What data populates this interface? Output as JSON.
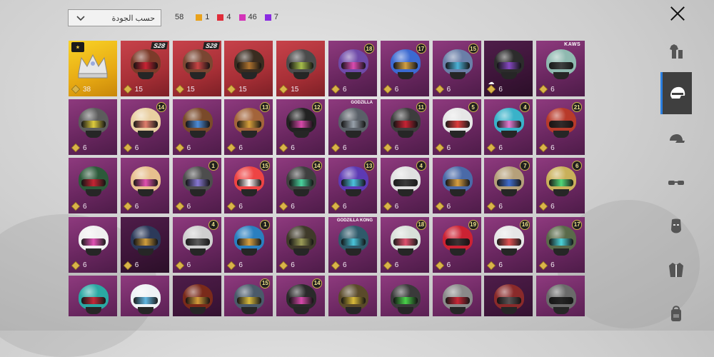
{
  "sort": {
    "label": "حسب الجودة"
  },
  "counts": {
    "total": "58",
    "by_quality": [
      {
        "value": "1",
        "color": "#e9a21b"
      },
      {
        "value": "4",
        "color": "#e02d3a"
      },
      {
        "value": "46",
        "color": "#d334b8"
      },
      {
        "value": "7",
        "color": "#8a2be2"
      }
    ]
  },
  "sidebar": [
    {
      "name": "outfit-tab",
      "icon": "outfit-icon",
      "active": false
    },
    {
      "name": "helmet-tab",
      "icon": "helmet-icon",
      "active": true
    },
    {
      "name": "hat-tab",
      "icon": "cap-icon",
      "active": false
    },
    {
      "name": "glasses-tab",
      "icon": "glasses-icon",
      "active": false
    },
    {
      "name": "mask-tab",
      "icon": "mask-icon",
      "active": false
    },
    {
      "name": "jacket-tab",
      "icon": "jacket-icon",
      "active": false
    },
    {
      "name": "backpack-tab",
      "icon": "backpack-icon",
      "active": false
    }
  ],
  "items": [
    {
      "rarity": "legendary",
      "cost": "38",
      "badge": "",
      "helmet": "#d7d7d7",
      "visor": "#9a9a9a",
      "crown": true
    },
    {
      "rarity": "mythic",
      "cost": "15",
      "tag": "S28",
      "helmet": "#7c3b2a",
      "visor": "#c23"
    },
    {
      "rarity": "mythic",
      "cost": "15",
      "tag": "S28",
      "helmet": "#7a4632",
      "visor": "#c44"
    },
    {
      "rarity": "mythic",
      "cost": "15",
      "helmet": "#3a2c20",
      "visor": "#b4762f"
    },
    {
      "rarity": "mythic",
      "cost": "15",
      "helmet": "#4b4b4b",
      "visor": "#a9c34a"
    },
    {
      "rarity": "epic",
      "cost": "6",
      "level": "18",
      "helmet": "#6f4aa8",
      "visor": "#e04bb1"
    },
    {
      "rarity": "epic",
      "cost": "6",
      "level": "17",
      "helmet": "#3c6ad1",
      "visor": "#d9a23b"
    },
    {
      "rarity": "epic",
      "cost": "6",
      "level": "15",
      "helmet": "#6a7fa8",
      "visor": "#4ab4d9"
    },
    {
      "rarity": "dark",
      "cost": "6",
      "helmet": "#2c2c2c",
      "visor": "#8a4ac9",
      "cloud": true
    },
    {
      "rarity": "epic",
      "cost": "6",
      "tag": "KAWS",
      "helmet": "#8fb9b0",
      "visor": "#3a3a3a"
    },
    {
      "rarity": "epic",
      "cost": "6",
      "helmet": "#5c5c5c",
      "visor": "#e4d13c"
    },
    {
      "rarity": "epic",
      "cost": "6",
      "level": "14",
      "helmet": "#e9cfa1",
      "visor": "#e07a6a"
    },
    {
      "rarity": "epic",
      "cost": "6",
      "helmet": "#7a4a2a",
      "visor": "#4b8fe0"
    },
    {
      "rarity": "epic",
      "cost": "6",
      "level": "13",
      "helmet": "#a3643a",
      "visor": "#d9a23b"
    },
    {
      "rarity": "epic",
      "cost": "6",
      "level": "12",
      "helmet": "#222",
      "visor": "#e04bb1"
    },
    {
      "rarity": "epic",
      "cost": "6",
      "tag": "GODZILLA",
      "helmet": "#5a6068",
      "visor": "#9aa3ad"
    },
    {
      "rarity": "epic",
      "cost": "6",
      "level": "11",
      "helmet": "#3d3d3d",
      "visor": "#c23"
    },
    {
      "rarity": "epic",
      "cost": "6",
      "level": "5",
      "helmet": "#e6e6e6",
      "visor": "#d33"
    },
    {
      "rarity": "epic",
      "cost": "6",
      "level": "4",
      "helmet": "#39b2c9",
      "visor": "#ea7ad0"
    },
    {
      "rarity": "epic",
      "cost": "6",
      "level": "21",
      "helmet": "#b83a2a",
      "visor": "#2a2a2a"
    },
    {
      "rarity": "epic",
      "cost": "6",
      "helmet": "#2d5a3a",
      "visor": "#c23"
    },
    {
      "rarity": "epic",
      "cost": "6",
      "helmet": "#e7c08e",
      "visor": "#e04bb1"
    },
    {
      "rarity": "epic",
      "cost": "6",
      "level": "1",
      "helmet": "#4d4d4d",
      "visor": "#8a7ad9"
    },
    {
      "rarity": "epic",
      "cost": "6",
      "level": "15",
      "helmet": "#e44",
      "visor": "#fff"
    },
    {
      "rarity": "epic",
      "cost": "6",
      "level": "14",
      "helmet": "#3f3f3f",
      "visor": "#4bd9a2"
    },
    {
      "rarity": "epic",
      "cost": "6",
      "level": "13",
      "helmet": "#5d3ab4",
      "visor": "#4bc9e0"
    },
    {
      "rarity": "epic",
      "cost": "6",
      "level": "4",
      "helmet": "#e0e0e0",
      "visor": "#333"
    },
    {
      "rarity": "epic",
      "cost": "6",
      "helmet": "#4a6aa8",
      "visor": "#e0a23b"
    },
    {
      "rarity": "epic",
      "cost": "6",
      "level": "7",
      "helmet": "#b5a07a",
      "visor": "#3a6ad1"
    },
    {
      "rarity": "epic",
      "cost": "6",
      "level": "6",
      "helmet": "#c9b05a",
      "visor": "#4bd97a"
    },
    {
      "rarity": "epic",
      "cost": "6",
      "helmet": "#f0f0f0",
      "visor": "#e04bb1"
    },
    {
      "rarity": "dark",
      "cost": "6",
      "helmet": "#2c3a5a",
      "visor": "#d9a23b"
    },
    {
      "rarity": "epic",
      "cost": "6",
      "level": "4",
      "helmet": "#cfcfcf",
      "visor": "#555"
    },
    {
      "rarity": "epic",
      "cost": "6",
      "level": "1",
      "helmet": "#2a7fbf",
      "visor": "#e0a23b"
    },
    {
      "rarity": "epic",
      "cost": "6",
      "helmet": "#3f3a2a",
      "visor": "#a0a05a"
    },
    {
      "rarity": "epic",
      "cost": "6",
      "tag": "GODZILLA KONG",
      "helmet": "#2f5a6a",
      "visor": "#4bc9e0"
    },
    {
      "rarity": "epic",
      "cost": "6",
      "level": "18",
      "helmet": "#d9e0d9",
      "visor": "#e04b6a"
    },
    {
      "rarity": "epic",
      "cost": "6",
      "level": "19",
      "helmet": "#c23",
      "visor": "#333"
    },
    {
      "rarity": "epic",
      "cost": "6",
      "level": "16",
      "helmet": "#e6e6e6",
      "visor": "#e04b4b"
    },
    {
      "rarity": "epic",
      "cost": "6",
      "level": "17",
      "helmet": "#5a6a4a",
      "visor": "#4bd9e0"
    },
    {
      "rarity": "epic",
      "helmet": "#2aa9a3",
      "visor": "#c23"
    },
    {
      "rarity": "epic",
      "helmet": "#eef2f5",
      "visor": "#5ab4e0"
    },
    {
      "rarity": "dark",
      "helmet": "#7a2a1a",
      "visor": "#d9a23b"
    },
    {
      "rarity": "epic",
      "level": "15",
      "helmet": "#4a5a6a",
      "visor": "#e0c03b"
    },
    {
      "rarity": "epic",
      "level": "14",
      "helmet": "#2a2a2a",
      "visor": "#e04bb1"
    },
    {
      "rarity": "epic",
      "helmet": "#5a4a2a",
      "visor": "#e0c03b"
    },
    {
      "rarity": "epic",
      "helmet": "#3a3a3a",
      "visor": "#4bd94b"
    },
    {
      "rarity": "epic",
      "helmet": "#8a8a8a",
      "visor": "#c23"
    },
    {
      "rarity": "dark",
      "helmet": "#8a2a2a",
      "visor": "#555"
    },
    {
      "rarity": "epic",
      "helmet": "#6a6a6a",
      "visor": "#222"
    }
  ]
}
